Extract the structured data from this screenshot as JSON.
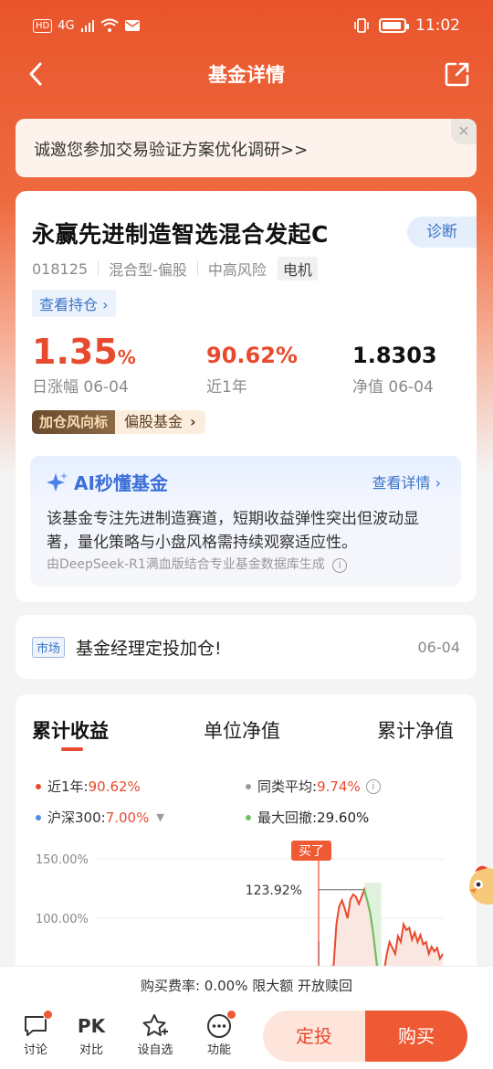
{
  "status_bar": {
    "network": "4G",
    "time": "11:02"
  },
  "nav": {
    "title": "基金详情"
  },
  "invite": {
    "text": "诚邀您参加交易验证方案优化调研>>"
  },
  "fund": {
    "name": "永赢先进制造智选混合发起C",
    "diagnose_label": "诊断",
    "code": "018125",
    "type": "混合型-偏股",
    "risk": "中高风险",
    "sector_tag": "电机",
    "holdings_link": "查看持仓 ›",
    "daily_change_value": "1.35",
    "daily_change_unit": "%",
    "daily_change_label": "日涨幅 06-04",
    "one_year_return": "90.62%",
    "one_year_label": "近1年",
    "nav_value": "1.8303",
    "nav_label": "净值 06-04",
    "rank_badge": "加仓风向标",
    "rank_category": "偏股基金",
    "rank_chevron": "›"
  },
  "ai": {
    "title": "AI秒懂基金",
    "detail_link": "查看详情 ›",
    "description": "该基金专注先进制造赛道，短期收益弹性突出但波动显著，量化策略与小盘风格需持续观察适应性。",
    "source": "由DeepSeek-R1满血版结合专业基金数据库生成"
  },
  "news": {
    "tag": "市场",
    "text": "基金经理定投加仓!",
    "date": "06-04"
  },
  "chart_tabs": [
    "累计收益",
    "单位净值",
    "累计净值"
  ],
  "legend": {
    "fund_label": "近1年:",
    "fund_value": "90.62%",
    "peer_label": "同类平均:",
    "peer_value": "9.74%",
    "index_label": "沪深300:",
    "index_value": "7.00%",
    "drawdown_label": "最大回撤:",
    "drawdown_value": "29.60%"
  },
  "chart_data": {
    "type": "line",
    "y_ticks": [
      "150.00%",
      "100.00%"
    ],
    "buy_marker": "买了",
    "peak_label": "123.92%",
    "series": [
      {
        "name": "近1年",
        "color": "#e84a2f",
        "values": [
          0,
          0,
          0,
          5,
          10,
          25,
          60,
          95,
          110,
          115,
          108,
          100,
          116,
          120,
          118,
          112,
          118,
          124,
          115,
          105,
          90,
          70,
          50,
          45,
          55,
          70,
          80,
          75,
          70,
          85,
          80,
          95,
          90,
          92,
          82,
          88,
          80,
          86,
          78,
          80,
          70,
          76,
          72,
          75,
          66,
          70
        ]
      }
    ],
    "drawdown_color": "#6cc264"
  },
  "bottom": {
    "fee_text": "购买费率: 0.00%  限大额  开放赎回",
    "tools": [
      {
        "label": "讨论"
      },
      {
        "label": "对比",
        "glyph": "PK"
      },
      {
        "label": "设自选"
      },
      {
        "label": "功能"
      }
    ],
    "sip_label": "定投",
    "buy_label": "购买"
  },
  "colors": {
    "brand": "#ee5a33",
    "up": "#e84a2f",
    "link": "#3b74c7"
  }
}
